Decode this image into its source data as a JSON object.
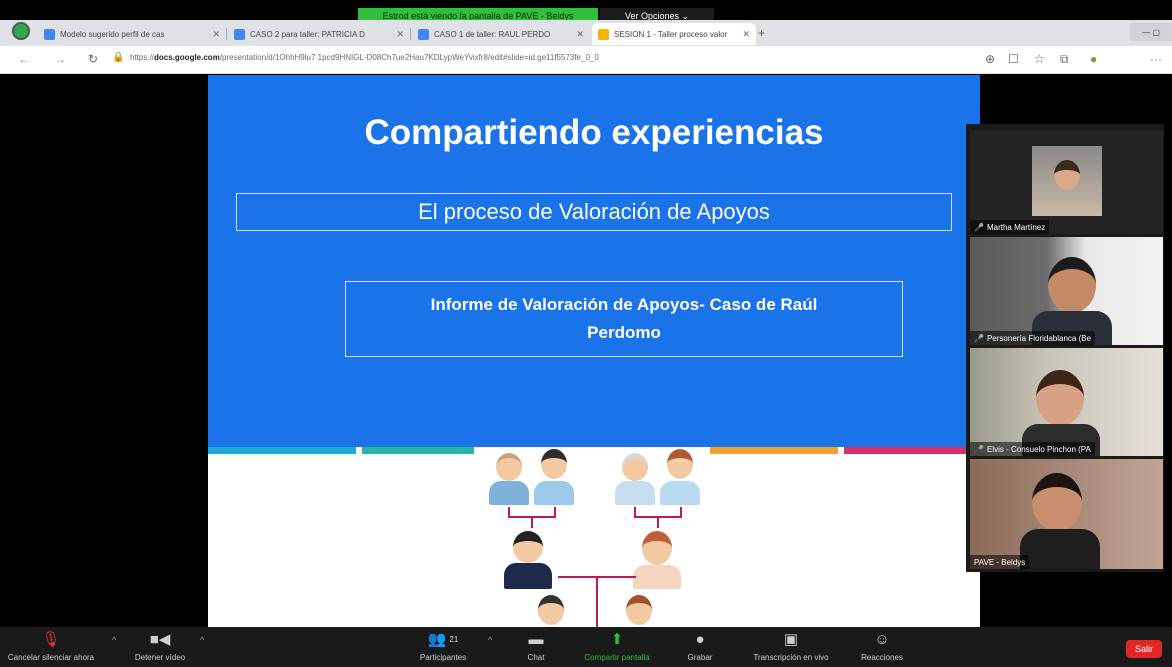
{
  "share_banner": {
    "text": "Estrod está viendo la pantalla de PAVE - Beldys",
    "view_options": "Ver Opciones ⌄"
  },
  "browser": {
    "tabs": [
      {
        "title": "Modelo sugerido perfil de cas",
        "close": "✕"
      },
      {
        "title": "CASO 2 para taller: PATRICIA D",
        "close": "✕"
      },
      {
        "title": "CASO 1 de taller: RAUL PERDO",
        "close": "✕"
      },
      {
        "title": "SESION 1 - Taller proceso valor",
        "close": "✕"
      }
    ],
    "new_tab": "+",
    "url_prefix": "https://",
    "url_domain": "docs.google.com",
    "url_rest": "/presentation/d/1OhhH9lu7 1pcd9HNIGL-D08Ch7ue2Hau7KDLypWeYvixfr8/edit#slide=id.ge11f5573fe_0_0"
  },
  "slide": {
    "title": "Compartiendo experiencias",
    "subtitle_box": "El proceso de Valoración de Apoyos",
    "report_line1": "Informe de Valoración de Apoyos- Caso de Raúl",
    "report_line2": "Perdomo"
  },
  "participants": [
    {
      "name": "Martha Martínez"
    },
    {
      "name": "Personería Floridablanca (Be"
    },
    {
      "name": "Elvis - Consuelo Pinchon (PA"
    },
    {
      "name": "PAVE - Beldys"
    }
  ],
  "toolbar": {
    "mute": "Cancelar silenciar ahora",
    "video": "Detener vídeo",
    "participants": "Participantes",
    "participants_count": "21",
    "chat": "Chat",
    "share": "Compartir pantalla",
    "record": "Grabar",
    "transcription": "Transcripción en vivo",
    "reactions": "Reacciones",
    "leave": "Salir"
  },
  "colors": {
    "slide_blue": "#1a73e8",
    "share_green": "#2fbf3a",
    "leave_red": "#e02828"
  }
}
